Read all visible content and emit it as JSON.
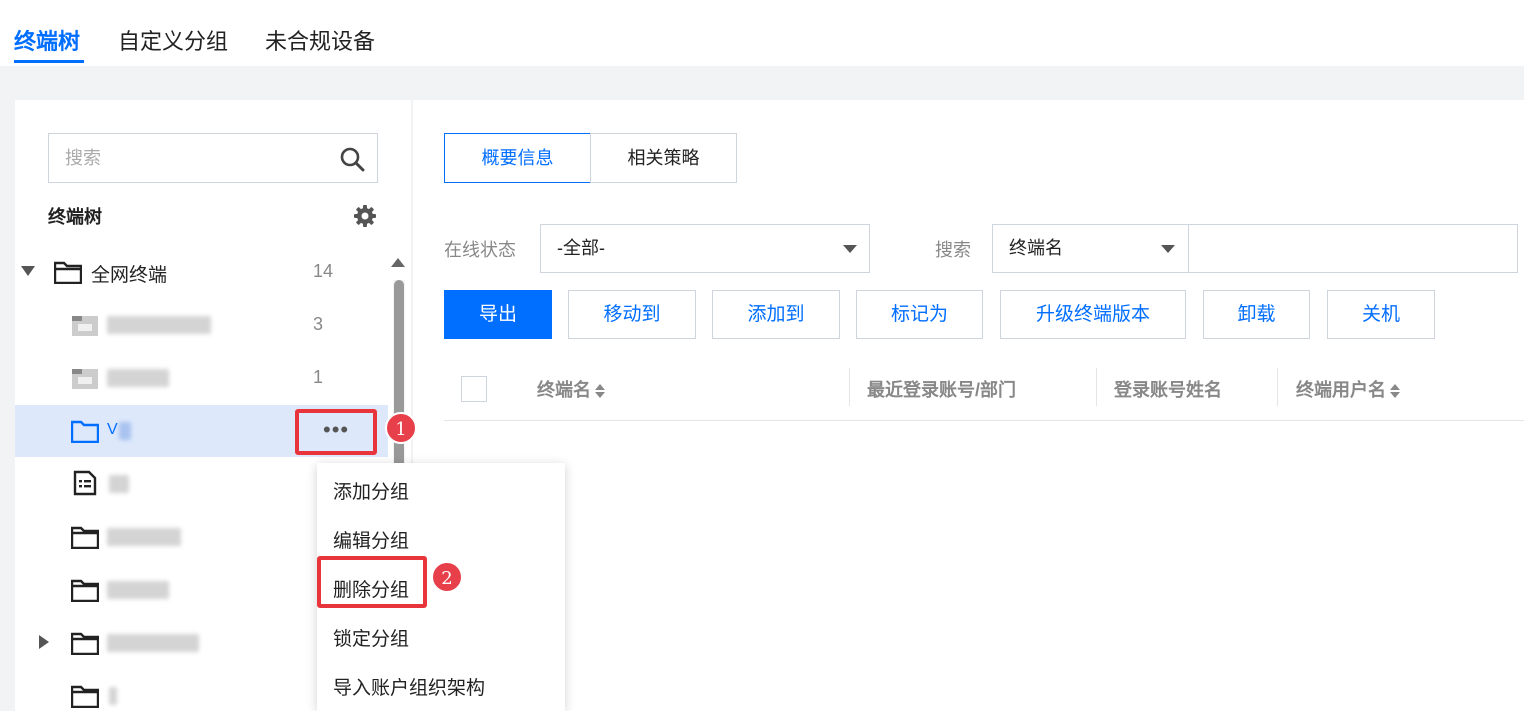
{
  "top_tabs": [
    "终端树",
    "自定义分组",
    "未合规设备"
  ],
  "left": {
    "search_placeholder": "搜索",
    "tree_title": "终端树",
    "root": {
      "label": "全网终端",
      "count": "14"
    },
    "children": [
      {
        "icon": "folder-filled-icon",
        "count": "3"
      },
      {
        "icon": "folder-filled-icon",
        "count": "1"
      },
      {
        "icon": "folder-icon",
        "label": "V",
        "selected": true
      },
      {
        "icon": "document-list-icon"
      },
      {
        "icon": "folder-icon"
      },
      {
        "icon": "folder-icon"
      },
      {
        "icon": "folder-icon",
        "expandable": true
      },
      {
        "icon": "folder-icon"
      }
    ],
    "more_label": "•••"
  },
  "right": {
    "seg_tabs": [
      "概要信息",
      "相关策略"
    ],
    "filter_status_label": "在线状态",
    "filter_status_value": "-全部-",
    "search_label": "搜索",
    "search_field_value": "终端名",
    "actions": [
      "导出",
      "移动到",
      "添加到",
      "标记为",
      "升级终端版本",
      "卸载",
      "关机"
    ],
    "columns": [
      "终端名",
      "最近登录账号/部门",
      "登录账号姓名",
      "终端用户名"
    ]
  },
  "menu": {
    "items": [
      "添加分组",
      "编辑分组",
      "删除分组",
      "锁定分组",
      "导入账户组织架构"
    ]
  },
  "badges": [
    "1",
    "2"
  ],
  "colors": {
    "accent": "#006eff",
    "highlight": "#e8353b",
    "selected_row": "#dde8fb"
  }
}
